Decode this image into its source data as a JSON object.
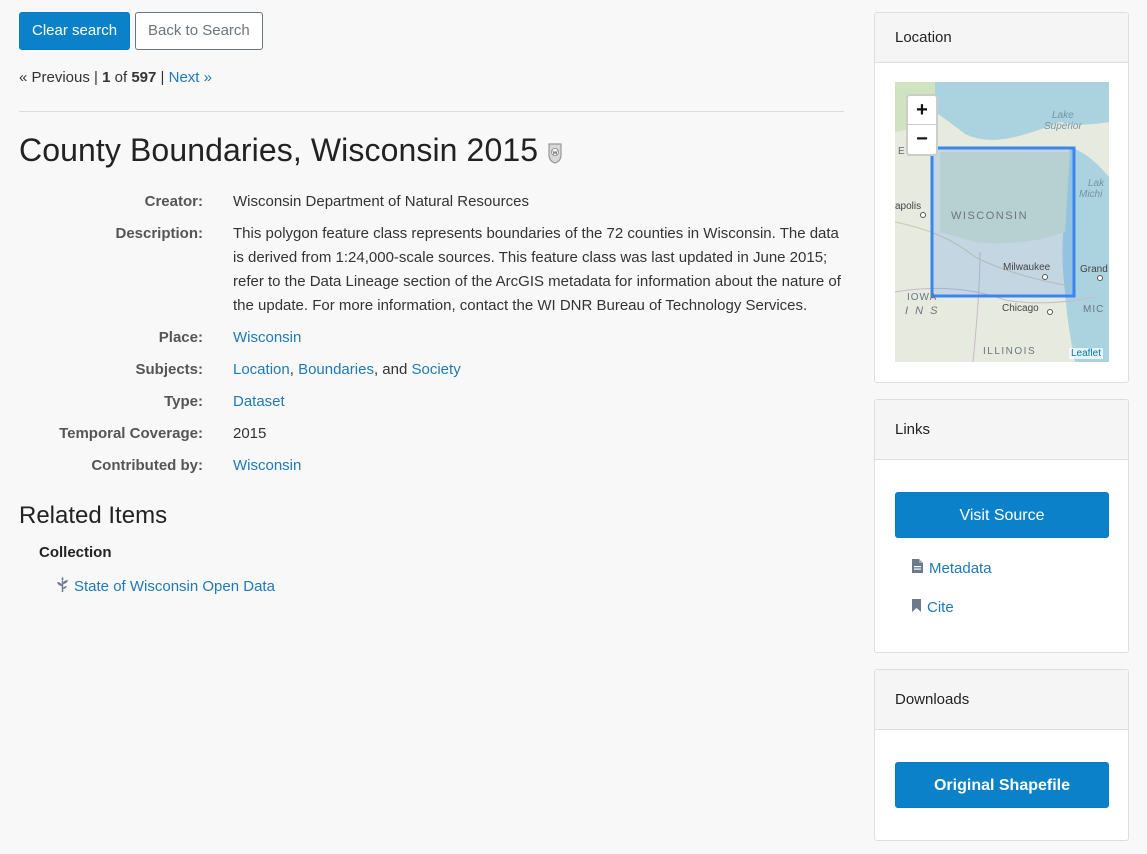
{
  "toolbar": {
    "clear_label": "Clear search",
    "back_label": "Back to Search"
  },
  "pager": {
    "prev": "« Previous",
    "sep": "|",
    "current": "1",
    "of": "of",
    "total": "597",
    "next": "Next »"
  },
  "record": {
    "title": "County Boundaries, Wisconsin 2015",
    "fields": {
      "creator_label": "Creator:",
      "creator": "Wisconsin Department of Natural Resources",
      "description_label": "Description:",
      "description": "This polygon feature class represents boundaries of the 72 counties in Wisconsin. The data is derived from 1:24,000-scale sources. This feature class was last updated in June 2015; refer to the Data Lineage section of the ArcGIS metadata for information about the nature of the update. For more information, contact the WI DNR Bureau of Technology Services.",
      "place_label": "Place:",
      "place": "Wisconsin",
      "subjects_label": "Subjects:",
      "subject_1": "Location",
      "subject_2": "Boundaries",
      "subject_3": "Society",
      "comma": ",",
      "and": ", and",
      "type_label": "Type:",
      "type": "Dataset",
      "temporal_label": "Temporal Coverage:",
      "temporal": "2015",
      "contributed_label": "Contributed by:",
      "contributed": "Wisconsin"
    }
  },
  "related": {
    "title": "Related Items",
    "collection_label": "Collection",
    "collection_item": "State of Wisconsin Open Data"
  },
  "sidebar": {
    "location": {
      "header": "Location",
      "zoom_in": "+",
      "zoom_out": "−",
      "labels": {
        "lake_superior_1": "Lake",
        "lake_superior_2": "Superior",
        "wisconsin": "WISCONSIN",
        "milwaukee": "Milwaukee",
        "chicago": "Chicago",
        "illinois": "ILLINOIS",
        "iowa": "IOWA",
        "ins": "I N S",
        "apolis": "apolis",
        "grand": "Grand",
        "mic": "MIC",
        "lake_mich_1": "Lak",
        "lake_mich_2": "Michi",
        "e": "E"
      },
      "attribution": "Leaflet"
    },
    "links": {
      "header": "Links",
      "visit": "Visit Source",
      "metadata": "Metadata",
      "cite": "Cite"
    },
    "downloads": {
      "header": "Downloads",
      "shapefile": "Original Shapefile"
    }
  },
  "colors": {
    "primary": "#0a81c9",
    "link": "#1f79b8",
    "bbox": "#3a86f0"
  }
}
